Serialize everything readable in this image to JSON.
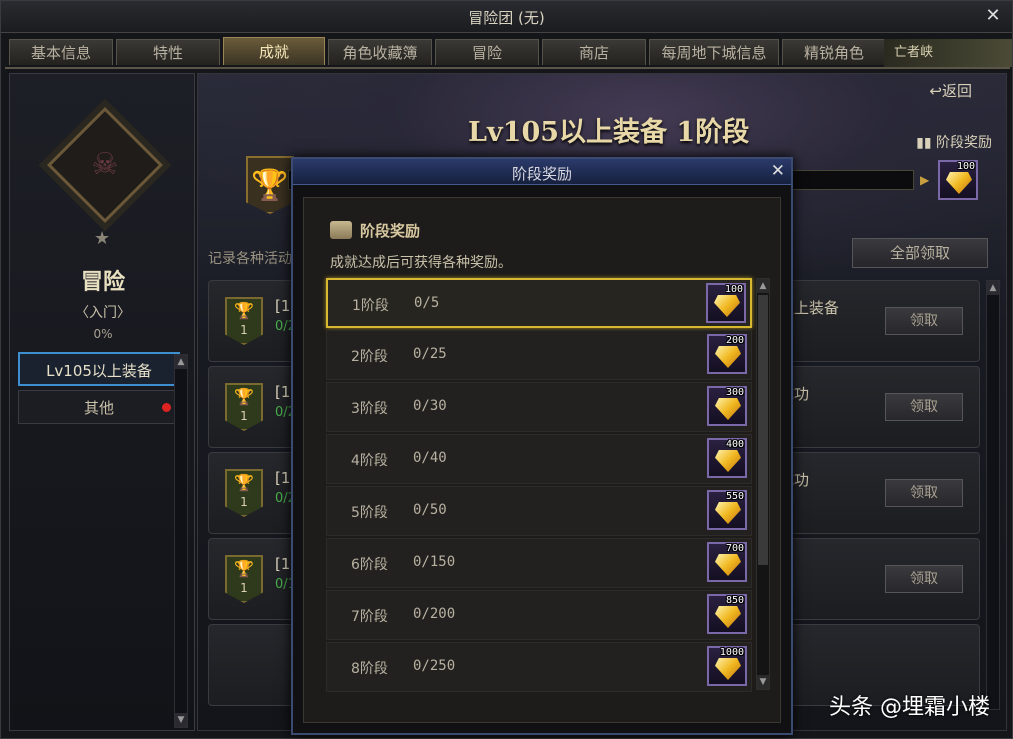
{
  "window": {
    "title": "冒险团 (无)",
    "close": "✕"
  },
  "tabs": [
    {
      "label": "基本信息"
    },
    {
      "label": "特性"
    },
    {
      "label": "成就",
      "active": true
    },
    {
      "label": "角色收藏簿"
    },
    {
      "label": "冒险"
    },
    {
      "label": "商店"
    },
    {
      "label": "每周地下城信息"
    },
    {
      "label": "精锐角色"
    }
  ],
  "tab_corner": "亡者峡",
  "left": {
    "rank_title": "冒险",
    "rank_sub": "〈入门〉",
    "rank_pct": "0%",
    "categories": [
      {
        "label": "Lv105以上装备",
        "active": true
      },
      {
        "label": "其他",
        "alert": true
      }
    ]
  },
  "main": {
    "back": "↩返回",
    "stage_title": "Lv105以上装备 1阶段",
    "stage_reward_label": "阶段奖励",
    "top_reward_value": "100",
    "desc": "记录各种活动",
    "claim_all": "全部领取",
    "achievements": [
      {
        "badge": "1",
        "name": "[10",
        "prog": "0/2",
        "right": "以上装备",
        "btn": "领取"
      },
      {
        "badge": "1",
        "name": "[10",
        "prog": "0/2",
        "right": "成功",
        "btn": "领取"
      },
      {
        "badge": "1",
        "name": "[10",
        "prog": "0/2",
        "right": "成功",
        "btn": "领取"
      },
      {
        "badge": "1",
        "name": "[10",
        "prog": "0/1",
        "right": "",
        "btn": "领取"
      }
    ]
  },
  "modal": {
    "title": "阶段奖励",
    "close": "✕",
    "section_title": "阶段奖励",
    "subtitle": "成就达成后可获得各种奖励。",
    "stages": [
      {
        "label": "1阶段",
        "count": "0/5",
        "reward": "100",
        "selected": true
      },
      {
        "label": "2阶段",
        "count": "0/25",
        "reward": "200"
      },
      {
        "label": "3阶段",
        "count": "0/30",
        "reward": "300"
      },
      {
        "label": "4阶段",
        "count": "0/40",
        "reward": "400"
      },
      {
        "label": "5阶段",
        "count": "0/50",
        "reward": "550"
      },
      {
        "label": "6阶段",
        "count": "0/150",
        "reward": "700"
      },
      {
        "label": "7阶段",
        "count": "0/200",
        "reward": "850"
      },
      {
        "label": "8阶段",
        "count": "0/250",
        "reward": "1000"
      }
    ]
  },
  "watermark": "头条 @埋霜小楼"
}
